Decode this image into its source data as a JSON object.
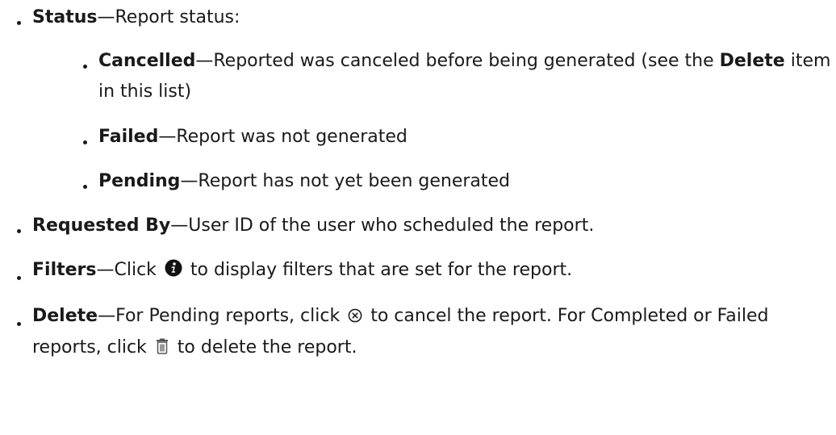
{
  "items": {
    "status": {
      "term": "Status",
      "desc": "—Report status:",
      "sub": {
        "cancelled": {
          "term": "Cancelled",
          "desc_a": "—Reported was canceled before being generated (see the ",
          "delete_term": "Delete",
          "desc_b": " item in this list)"
        },
        "failed": {
          "term": "Failed",
          "desc": "—Report was not generated"
        },
        "pending": {
          "term": "Pending",
          "desc": "—Report has not yet been generated"
        }
      }
    },
    "requested_by": {
      "term": "Requested By",
      "desc": "—User ID of the user who scheduled the report."
    },
    "filters": {
      "term": "Filters",
      "desc_a": "—Click ",
      "icon": "info-icon",
      "desc_b": " to display filters that are set for the report."
    },
    "delete": {
      "term": "Delete",
      "desc_a": "—For Pending reports, click ",
      "cancel_icon": "cancel-circle-icon",
      "desc_b": " to cancel the report. For Completed or Failed reports, click ",
      "trash_icon": "trash-icon",
      "desc_c": " to delete the report."
    }
  }
}
